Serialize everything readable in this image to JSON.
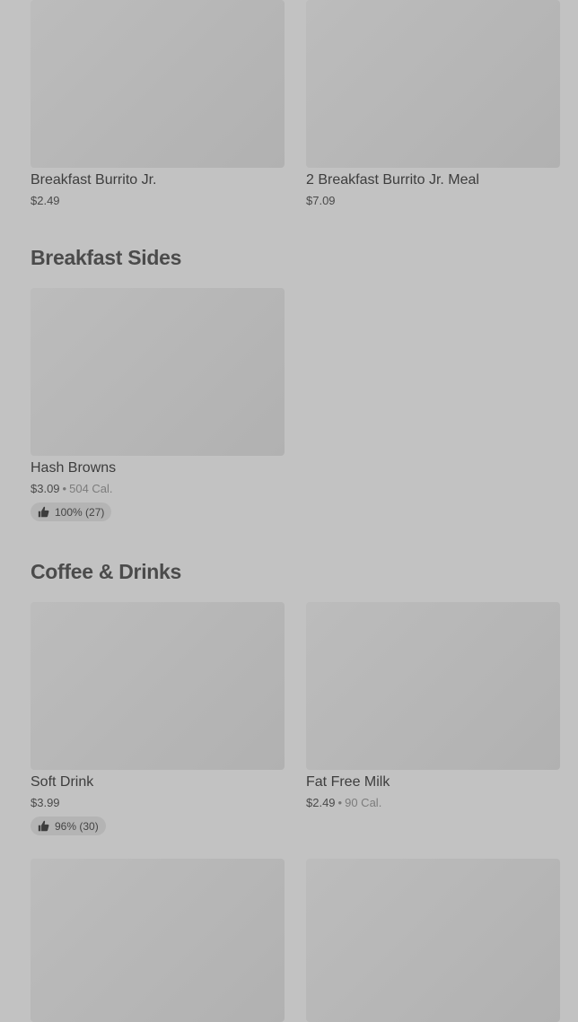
{
  "sections": {
    "breakfast_sides_title": "Breakfast Sides",
    "coffee_drinks_title": "Coffee & Drinks"
  },
  "items": {
    "breakfast_burrito_jr": {
      "name": "Breakfast Burrito Jr.",
      "price": "$2.49"
    },
    "two_breakfast_burrito_jr_meal": {
      "name": "2 Breakfast Burrito Jr. Meal",
      "price": "$7.09"
    },
    "hash_browns": {
      "name": "Hash Browns",
      "price": "$3.09",
      "calories": "504 Cal.",
      "rating": "100% (27)"
    },
    "soft_drink": {
      "name": "Soft Drink",
      "price": "$3.99",
      "rating": "96% (30)"
    },
    "fat_free_milk": {
      "name": "Fat Free Milk",
      "price": "$2.49",
      "calories": "90 Cal."
    }
  },
  "separator": "•",
  "icons": {
    "rating": "thumbs-up-icon"
  }
}
